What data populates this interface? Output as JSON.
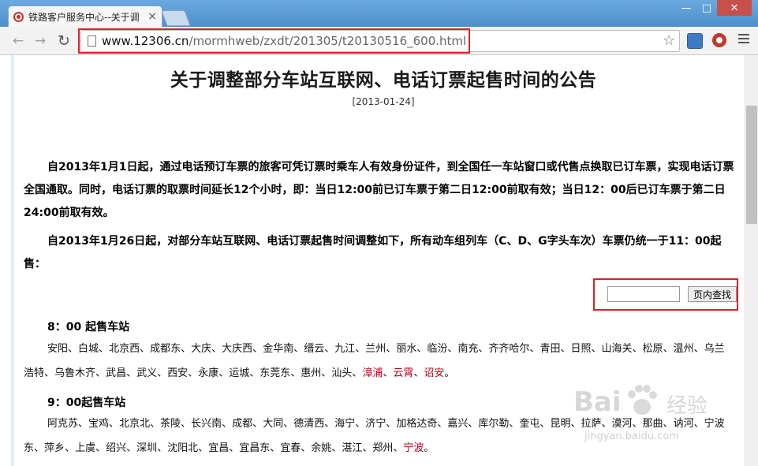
{
  "browser": {
    "tab_title": "铁路客户服务中心--关于调",
    "tab_close": "×",
    "window_controls": [
      "—",
      "□",
      "✕"
    ],
    "nav_back": "←",
    "nav_forward": "→",
    "nav_reload": "↻",
    "url_host": "www.12306.cn",
    "url_path": "/mormhweb/zxdt/201305/t20130516_600.html",
    "star": "☆",
    "icons": [
      "page-icon",
      "star-icon",
      "extension-icon",
      "12306-icon",
      "menu-icon"
    ]
  },
  "article": {
    "title": "关于调整部分车站互联网、电话订票起售时间的公告",
    "date": "[2013-01-24]",
    "paragraph1": "自2013年1月1日起，通过电话预订车票的旅客可凭订票时乘车人有效身份证件，到全国任一车站窗口或代售点换取已订车票，实现电话订票全国通取。同时，电话订票的取票时间延长12个小时，即：当日12:00前已订车票于第二日12:00前取有效；当日12：00后已订车票于第二日24:00前取有效。",
    "paragraph2": "自2013年1月26日起，对部分车站互联网、电话订票起售时间调整如下，所有动车组列车（C、D、G字头车次）车票仍统一于11：00起售："
  },
  "find": {
    "input_value": "",
    "button_label": "页内查找"
  },
  "sections": [
    {
      "heading": "8：00 起售车站",
      "stations": [
        {
          "name": "安阳",
          "highlight": false
        },
        {
          "name": "白城",
          "highlight": false
        },
        {
          "name": "北京西",
          "highlight": false
        },
        {
          "name": "成都东",
          "highlight": false
        },
        {
          "name": "大庆",
          "highlight": false
        },
        {
          "name": "大庆西",
          "highlight": false
        },
        {
          "name": "金华南",
          "highlight": false
        },
        {
          "name": "缙云",
          "highlight": false
        },
        {
          "name": "九江",
          "highlight": false
        },
        {
          "name": "兰州",
          "highlight": false
        },
        {
          "name": "丽水",
          "highlight": false
        },
        {
          "name": "临汾",
          "highlight": false
        },
        {
          "name": "南充",
          "highlight": false
        },
        {
          "name": "齐齐哈尔",
          "highlight": false
        },
        {
          "name": "青田",
          "highlight": false
        },
        {
          "name": "日照",
          "highlight": false
        },
        {
          "name": "山海关",
          "highlight": false
        },
        {
          "name": "松原",
          "highlight": false
        },
        {
          "name": "温州",
          "highlight": false
        },
        {
          "name": "乌兰浩特",
          "highlight": false
        },
        {
          "name": "乌鲁木齐",
          "highlight": false
        },
        {
          "name": "武昌",
          "highlight": false
        },
        {
          "name": "武义",
          "highlight": false
        },
        {
          "name": "西安",
          "highlight": false
        },
        {
          "name": "永康",
          "highlight": false
        },
        {
          "name": "运城",
          "highlight": false
        },
        {
          "name": "东莞东",
          "highlight": false
        },
        {
          "name": "惠州",
          "highlight": false
        },
        {
          "name": "汕头",
          "highlight": false
        },
        {
          "name": "漳浦",
          "highlight": true
        },
        {
          "name": "云霄",
          "highlight": true
        },
        {
          "name": "诏安",
          "highlight": true
        }
      ]
    },
    {
      "heading": "9：00起售车站",
      "stations": [
        {
          "name": "阿克苏",
          "highlight": false
        },
        {
          "name": "宝鸡",
          "highlight": false
        },
        {
          "name": "北京北",
          "highlight": false
        },
        {
          "name": "茶陵",
          "highlight": false
        },
        {
          "name": "长兴南",
          "highlight": false
        },
        {
          "name": "成都",
          "highlight": false
        },
        {
          "name": "大同",
          "highlight": false
        },
        {
          "name": "德清西",
          "highlight": false
        },
        {
          "name": "海宁",
          "highlight": false
        },
        {
          "name": "济宁",
          "highlight": false
        },
        {
          "name": "加格达奇",
          "highlight": false
        },
        {
          "name": "嘉兴",
          "highlight": false
        },
        {
          "name": "库尔勒",
          "highlight": false
        },
        {
          "name": "奎屯",
          "highlight": false
        },
        {
          "name": "昆明",
          "highlight": false
        },
        {
          "name": "拉萨",
          "highlight": false
        },
        {
          "name": "漠河",
          "highlight": false
        },
        {
          "name": "那曲",
          "highlight": false
        },
        {
          "name": "讷河",
          "highlight": false
        },
        {
          "name": "宁波东",
          "highlight": false
        },
        {
          "name": "萍乡",
          "highlight": false
        },
        {
          "name": "上虞",
          "highlight": false
        },
        {
          "name": "绍兴",
          "highlight": false
        },
        {
          "name": "深圳",
          "highlight": false
        },
        {
          "name": "沈阳北",
          "highlight": false
        },
        {
          "name": "宜昌",
          "highlight": false
        },
        {
          "name": "宜昌东",
          "highlight": false
        },
        {
          "name": "宜春",
          "highlight": false
        },
        {
          "name": "余姚",
          "highlight": false
        },
        {
          "name": "湛江",
          "highlight": false
        },
        {
          "name": "郑州",
          "highlight": false
        },
        {
          "name": "宁波",
          "highlight": true
        }
      ]
    }
  ],
  "separator": "、",
  "terminator": "。",
  "watermark": {
    "brand": "Bai",
    "brand_tail": "经验",
    "url": "jingyan.baidu.com"
  },
  "colors": {
    "highlight_box": "#d9222a",
    "station_red": "#c0001a",
    "tabstrip": "#5b9bd5"
  }
}
